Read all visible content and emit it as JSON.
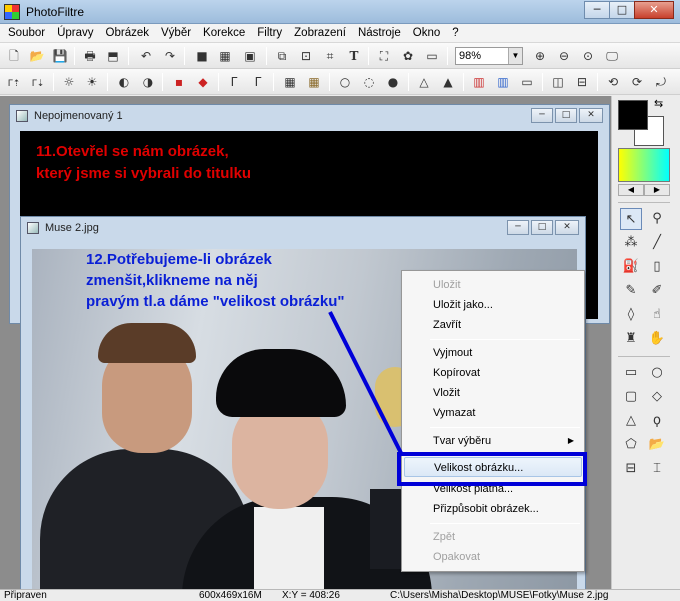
{
  "window": {
    "title": "PhotoFiltre",
    "minimize_icon": "minimize-icon",
    "maximize_icon": "maximize-icon",
    "close_icon": "close-icon"
  },
  "menu": [
    "Soubor",
    "Úpravy",
    "Obrázek",
    "Výběr",
    "Korekce",
    "Filtry",
    "Zobrazení",
    "Nástroje",
    "Okno",
    "?"
  ],
  "toolbar": {
    "zoom_value": "98%"
  },
  "documents": {
    "doc1": {
      "title": "Nepojmenovaný 1",
      "annotation_line1": "11.Otevřel se nám obrázek,",
      "annotation_line2": "který jsme si vybrali do titulku"
    },
    "doc2": {
      "title": "Muse 2.jpg",
      "annotation_line1": "12.Potřebujeme-li obrázek",
      "annotation_line2": "zmenšit,klikneme na něj",
      "annotation_line3": "pravým tl.a dáme \"velikost obrázku\""
    }
  },
  "context_menu": {
    "items": [
      {
        "label": "Uložit",
        "disabled": true
      },
      {
        "label": "Uložit jako...",
        "disabled": false
      },
      {
        "label": "Zavřít",
        "disabled": false
      },
      {
        "label": "Vyjmout",
        "disabled": false
      },
      {
        "label": "Kopírovat",
        "disabled": false
      },
      {
        "label": "Vložit",
        "disabled": false
      },
      {
        "label": "Vymazat",
        "disabled": false
      },
      {
        "label": "Tvar výběru",
        "disabled": false,
        "submenu": true
      },
      {
        "label": "Velikost obrázku...",
        "disabled": false,
        "highlighted": true
      },
      {
        "label": "Velikost plátna...",
        "disabled": false
      },
      {
        "label": "Přizpůsobit obrázek...",
        "disabled": false
      },
      {
        "label": "Zpět",
        "disabled": true
      },
      {
        "label": "Opakovat",
        "disabled": true
      }
    ]
  },
  "colors": {
    "foreground": "#000000",
    "background": "#ffffff",
    "gradient_start": "#ffff00",
    "gradient_end": "#00ffff",
    "annotation_red": "#e00000",
    "annotation_blue": "#0a1fd6",
    "highlight_box": "#0000d8"
  },
  "status": {
    "state": "Připraven",
    "dimensions": "600x469x16M",
    "coords": "X:Y = 408:26",
    "path": "C:\\Users\\Misha\\Desktop\\MUSE\\Fotky\\Muse 2.jpg"
  }
}
